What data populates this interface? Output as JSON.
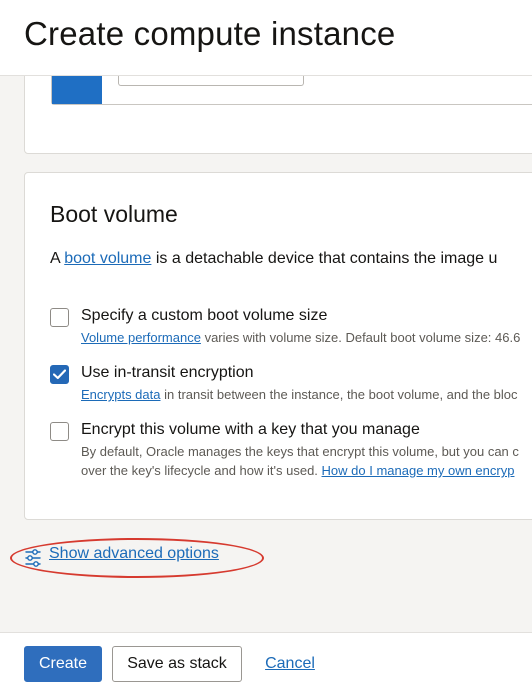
{
  "header": {
    "title": "Create compute instance"
  },
  "boot_volume": {
    "heading": "Boot volume",
    "description_prefix": "A ",
    "description_link": "boot volume",
    "description_suffix": " is a detachable device that contains the image u",
    "options": [
      {
        "label": "Specify a custom boot volume size",
        "checked": false,
        "help_link": "Volume performance",
        "help_text": " varies with volume size. Default boot volume size: 46.6"
      },
      {
        "label": "Use in-transit encryption",
        "checked": true,
        "help_link": "Encrypts data",
        "help_text": " in transit between the instance, the boot volume, and the bloc"
      },
      {
        "label": "Encrypt this volume with a key that you manage",
        "checked": false,
        "help_text": "By default, Oracle manages the keys that encrypt this volume, but you can c",
        "help_text2": "over the key's lifecycle and how it's used. ",
        "help_link2": "How do I manage my own encryp"
      }
    ]
  },
  "advanced": {
    "label": "Show advanced options",
    "icon": "sliders-icon"
  },
  "footer": {
    "create_label": "Create",
    "save_stack_label": "Save as stack",
    "cancel_label": "Cancel"
  },
  "colors": {
    "primary": "#2f6ebd",
    "link": "#1c6bb8",
    "annotation_oval": "#d63a2f"
  }
}
